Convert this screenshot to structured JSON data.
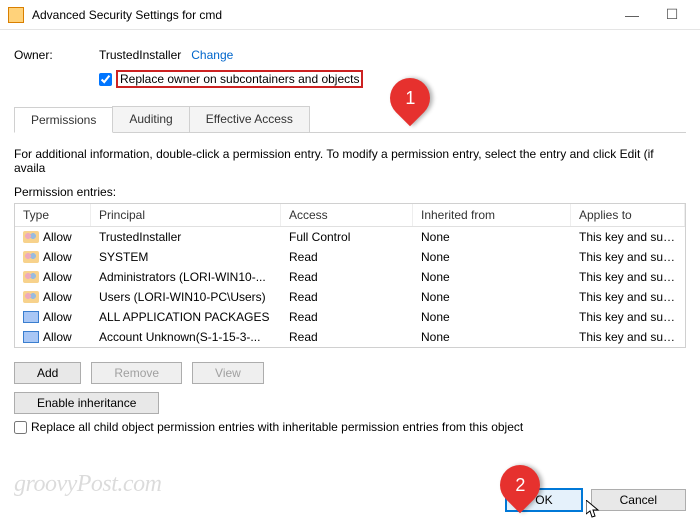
{
  "window": {
    "title": "Advanced Security Settings for cmd"
  },
  "owner": {
    "label": "Owner:",
    "value": "TrustedInstaller",
    "change_link": "Change",
    "replace_checkbox_label": "Replace owner on subcontainers and objects",
    "replace_checked": true
  },
  "tabs": [
    {
      "label": "Permissions",
      "active": true
    },
    {
      "label": "Auditing",
      "active": false
    },
    {
      "label": "Effective Access",
      "active": false
    }
  ],
  "info_text": "For additional information, double-click a permission entry. To modify a permission entry, select the entry and click Edit (if availa",
  "entries_label": "Permission entries:",
  "columns": {
    "c1": "Type",
    "c2": "Principal",
    "c3": "Access",
    "c4": "Inherited from",
    "c5": "Applies to"
  },
  "rows": [
    {
      "icon": "users",
      "type": "Allow",
      "principal": "TrustedInstaller",
      "access": "Full Control",
      "inherited": "None",
      "applies": "This key and subkeys"
    },
    {
      "icon": "users",
      "type": "Allow",
      "principal": "SYSTEM",
      "access": "Read",
      "inherited": "None",
      "applies": "This key and subkeys"
    },
    {
      "icon": "users",
      "type": "Allow",
      "principal": "Administrators (LORI-WIN10-...",
      "access": "Read",
      "inherited": "None",
      "applies": "This key and subkeys"
    },
    {
      "icon": "users",
      "type": "Allow",
      "principal": "Users (LORI-WIN10-PC\\Users)",
      "access": "Read",
      "inherited": "None",
      "applies": "This key and subkeys"
    },
    {
      "icon": "package",
      "type": "Allow",
      "principal": "ALL APPLICATION PACKAGES",
      "access": "Read",
      "inherited": "None",
      "applies": "This key and subkeys"
    },
    {
      "icon": "package",
      "type": "Allow",
      "principal": "Account Unknown(S-1-15-3-...",
      "access": "Read",
      "inherited": "None",
      "applies": "This key and subkeys"
    }
  ],
  "buttons": {
    "add": "Add",
    "remove": "Remove",
    "view": "View",
    "enable_inheritance": "Enable inheritance",
    "ok": "OK",
    "cancel": "Cancel"
  },
  "replace_all_checkbox": {
    "label": "Replace all child object permission entries with inheritable permission entries from this object",
    "checked": false
  },
  "watermark": "groovyPost.com",
  "annotations": {
    "a1": "1",
    "a2": "2"
  }
}
